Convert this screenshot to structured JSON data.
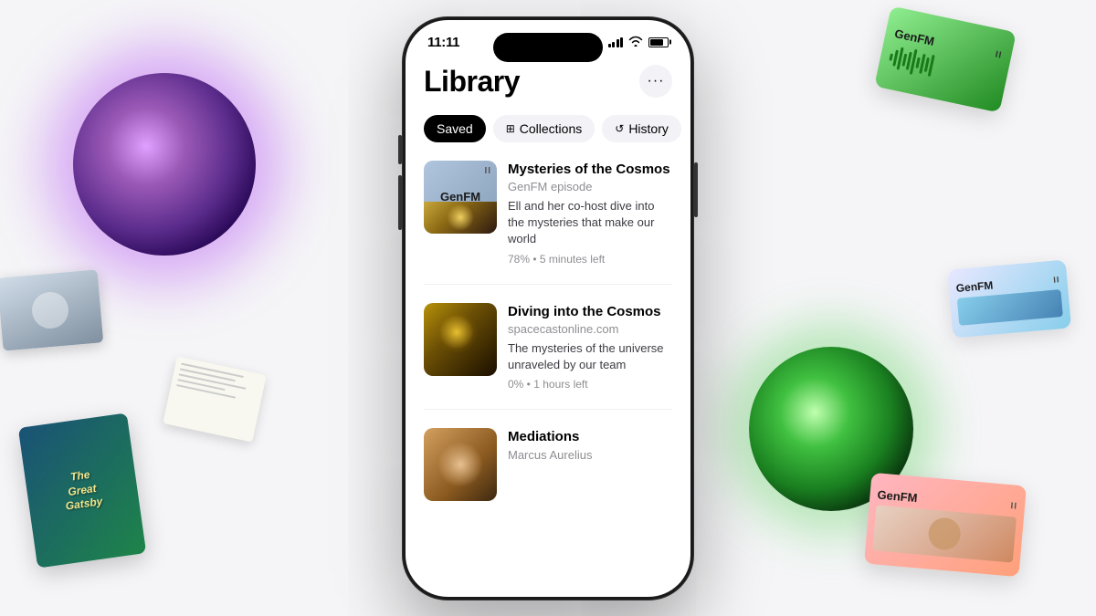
{
  "background": {
    "color": "#f5f5f7"
  },
  "decorative": {
    "purple_cone_visible": true,
    "green_cone_visible": true,
    "gatsby_book_title": "The\nGreat\nGatsby",
    "genfm_top_label": "GenFM",
    "genfm_mid_label": "GenFM",
    "genfm_bottom_label": "GenFM"
  },
  "phone": {
    "status_bar": {
      "time": "11:11",
      "signal_bars": [
        3,
        5,
        7,
        9,
        11
      ],
      "battery_label": ""
    },
    "header": {
      "title": "Library",
      "more_button_label": "···"
    },
    "tabs": [
      {
        "id": "saved",
        "label": "Saved",
        "active": true,
        "icon": ""
      },
      {
        "id": "collections",
        "label": "Collections",
        "active": false,
        "icon": "⊞"
      },
      {
        "id": "history",
        "label": "History",
        "active": false,
        "icon": "↺"
      }
    ],
    "items": [
      {
        "id": "item-1",
        "title": "Mysteries of the Cosmos",
        "source": "GenFM episode",
        "description": "Ell and her co-host dive into the mysteries that make our world",
        "meta": "78% • 5 minutes left",
        "thumbnail_type": "genfm",
        "thumbnail_label": "GenFM",
        "pause_icon": "II"
      },
      {
        "id": "item-2",
        "title": "Diving into the Cosmos",
        "source": "spacecastonline.com",
        "description": "The mysteries of the universe unraveled by our team",
        "meta": "0% • 1 hours left",
        "thumbnail_type": "cosmos",
        "thumbnail_label": ""
      },
      {
        "id": "item-3",
        "title": "Mediations",
        "source": "Marcus Aurelius",
        "description": "",
        "meta": "",
        "thumbnail_type": "meditations",
        "thumbnail_label": ""
      }
    ]
  }
}
